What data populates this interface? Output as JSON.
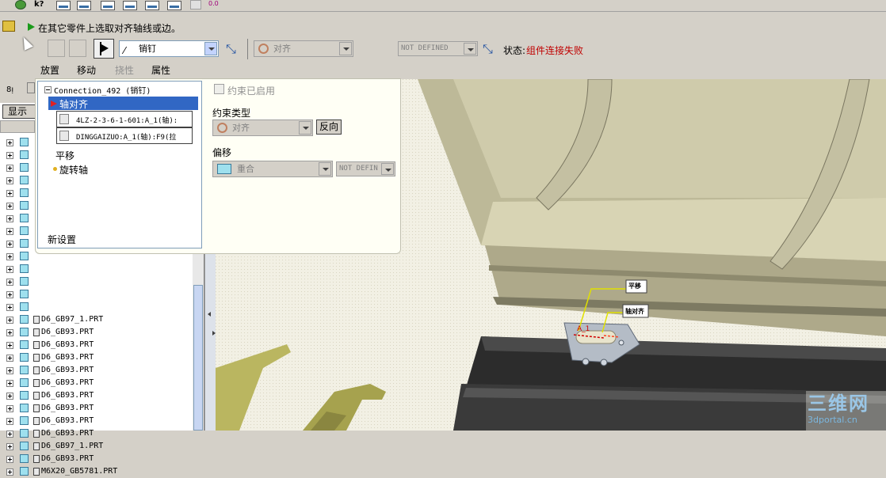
{
  "prompt": {
    "message": "在其它零件上选取对齐轴线或边。"
  },
  "dashboard": {
    "connection_type": "销钉",
    "constraint_type": "对齐",
    "offset_value": "NOT DEFINED",
    "status_label": "状态:",
    "status_value": "组件连接失败"
  },
  "tabs": [
    {
      "label": "放置"
    },
    {
      "label": "移动"
    },
    {
      "label": "挠性"
    },
    {
      "label": "属性"
    }
  ],
  "placement": {
    "connection_name": "Connection_492 (销钉)",
    "selected_item": "轴对齐",
    "ref1": "4LZ-2-3-6-1-601:A_1(轴):",
    "ref2": "DINGGAIZUO:A_1(轴):F9(拉",
    "translation": "平移",
    "rotation_axis": "旋转轴",
    "new_set": "新设置",
    "constraint_enabled_label": "约束已启用",
    "constraint_type_label": "约束类型",
    "constraint_type_value": "对齐",
    "flip_label": "反向",
    "offset_label": "偏移",
    "offset_value": "重合",
    "offset_amount": "NOT DEFIN"
  },
  "tree": {
    "show_label": "显示",
    "items": [
      "D6_GB97_1.PRT",
      "D6_GB93.PRT",
      "D6_GB93.PRT",
      "D6_GB93.PRT",
      "D6_GB93.PRT",
      "D6_GB93.PRT",
      "D6_GB93.PRT",
      "D6_GB93.PRT",
      "D6_GB93.PRT",
      "D6_GB93.PRT",
      "D6_GB97_1.PRT",
      "D6_GB93.PRT",
      "M6X20_GB5781.PRT"
    ]
  },
  "viewport": {
    "callout1": "平移",
    "callout2": "轴对齐",
    "axis_label": "A_1",
    "watermark": "三维网",
    "watermark_url": "3dportal.cn"
  }
}
